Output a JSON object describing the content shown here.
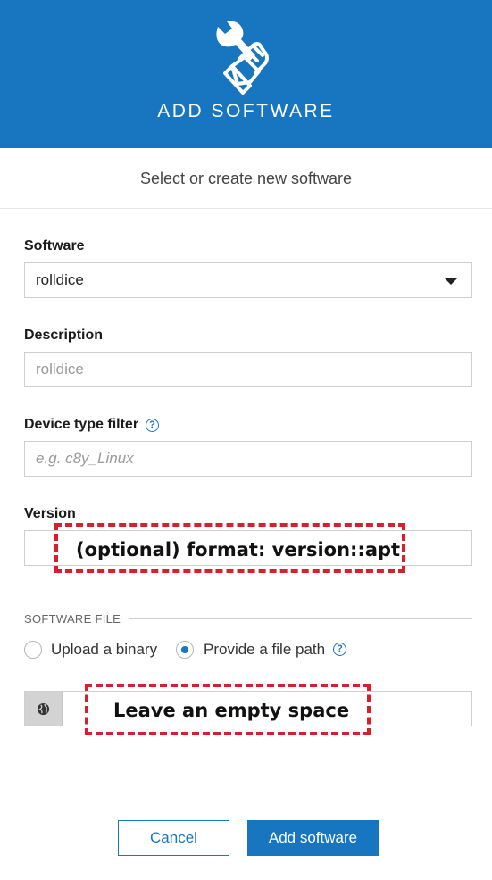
{
  "header": {
    "icon": "wrench-hand-icon",
    "title": "ADD SOFTWARE",
    "background": "#1776bf"
  },
  "subtitle": "Select or create new software",
  "form": {
    "software": {
      "label": "Software",
      "value": "rolldice"
    },
    "description": {
      "label": "Description",
      "placeholder": "rolldice"
    },
    "device_type_filter": {
      "label": "Device type filter",
      "placeholder": "e.g. c8y_Linux",
      "help_icon": "question-circle-icon"
    },
    "version": {
      "label": "Version",
      "value": ""
    }
  },
  "software_file": {
    "section_title": "SOFTWARE FILE",
    "options": [
      {
        "label": "Upload a binary",
        "checked": false
      },
      {
        "label": "Provide a file path",
        "checked": true
      }
    ],
    "help_icon": "question-circle-icon",
    "path_icon": "globe-icon",
    "path_value": ""
  },
  "annotations": {
    "version_note": "(optional) format: version::apt",
    "path_note": "Leave an empty space",
    "color": "#d6202d"
  },
  "footer": {
    "cancel_label": "Cancel",
    "add_label": "Add software"
  }
}
